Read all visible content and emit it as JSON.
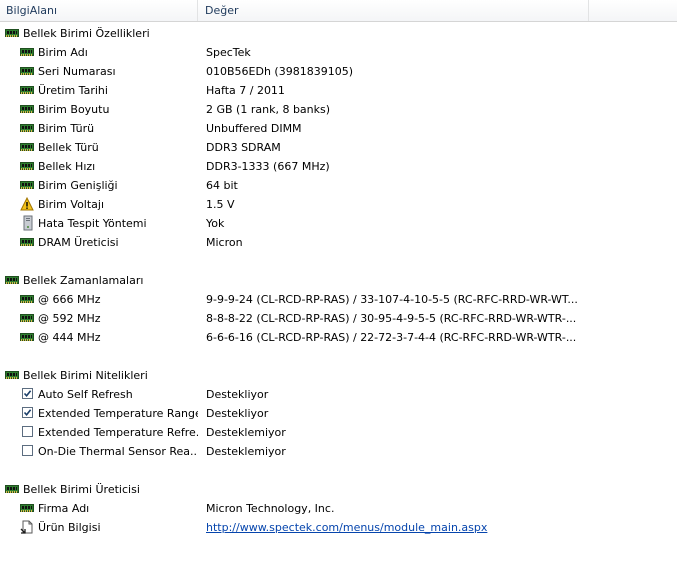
{
  "header": {
    "col1": "BilgiAlanı",
    "col2": "Değer"
  },
  "groups": [
    {
      "title": "Bellek Birimi Özellikleri",
      "items": [
        {
          "label": "Birim Adı",
          "value": "SpecTek",
          "icon": "ram-icon"
        },
        {
          "label": "Seri Numarası",
          "value": "010B56EDh (3981839105)",
          "icon": "ram-icon"
        },
        {
          "label": "Üretim Tarihi",
          "value": "Hafta 7 / 2011",
          "icon": "ram-icon"
        },
        {
          "label": "Birim Boyutu",
          "value": "2 GB (1 rank, 8 banks)",
          "icon": "ram-icon"
        },
        {
          "label": "Birim Türü",
          "value": "Unbuffered DIMM",
          "icon": "ram-icon"
        },
        {
          "label": "Bellek Türü",
          "value": "DDR3 SDRAM",
          "icon": "ram-icon"
        },
        {
          "label": "Bellek Hızı",
          "value": "DDR3-1333 (667 MHz)",
          "icon": "ram-icon"
        },
        {
          "label": "Birim Genişliği",
          "value": "64 bit",
          "icon": "ram-icon"
        },
        {
          "label": "Birim Voltajı",
          "value": "1.5 V",
          "icon": "warning-icon"
        },
        {
          "label": "Hata Tespit Yöntemi",
          "value": "Yok",
          "icon": "pc-tower-icon"
        },
        {
          "label": "DRAM Üreticisi",
          "value": "Micron",
          "icon": "ram-icon"
        }
      ]
    },
    {
      "title": "Bellek Zamanlamaları",
      "items": [
        {
          "label": "@ 666 MHz",
          "value": "9-9-9-24  (CL-RCD-RP-RAS) / 33-107-4-10-5-5  (RC-RFC-RRD-WR-WT...",
          "icon": "ram-icon"
        },
        {
          "label": "@ 592 MHz",
          "value": "8-8-8-22  (CL-RCD-RP-RAS) / 30-95-4-9-5-5  (RC-RFC-RRD-WR-WTR-...",
          "icon": "ram-icon"
        },
        {
          "label": "@ 444 MHz",
          "value": "6-6-6-16  (CL-RCD-RP-RAS) / 22-72-3-7-4-4  (RC-RFC-RRD-WR-WTR-...",
          "icon": "ram-icon"
        }
      ]
    },
    {
      "title": "Bellek Birimi Nitelikleri",
      "items": [
        {
          "label": "Auto Self Refresh",
          "value": "Destekliyor",
          "checked": true
        },
        {
          "label": "Extended Temperature Range",
          "value": "Destekliyor",
          "checked": true
        },
        {
          "label": "Extended Temperature Refre...",
          "value": "Desteklemiyor",
          "checked": false
        },
        {
          "label": "On-Die Thermal Sensor Rea...",
          "value": "Desteklemiyor",
          "checked": false
        }
      ]
    },
    {
      "title": "Bellek Birimi Üreticisi",
      "items": [
        {
          "label": "Firma Adı",
          "value": "Micron Technology, Inc.",
          "icon": "ram-icon"
        },
        {
          "label": "Ürün Bilgisi",
          "value": "http://www.spectek.com/menus/module_main.aspx",
          "icon": "web-page-icon",
          "link": true
        }
      ]
    }
  ]
}
